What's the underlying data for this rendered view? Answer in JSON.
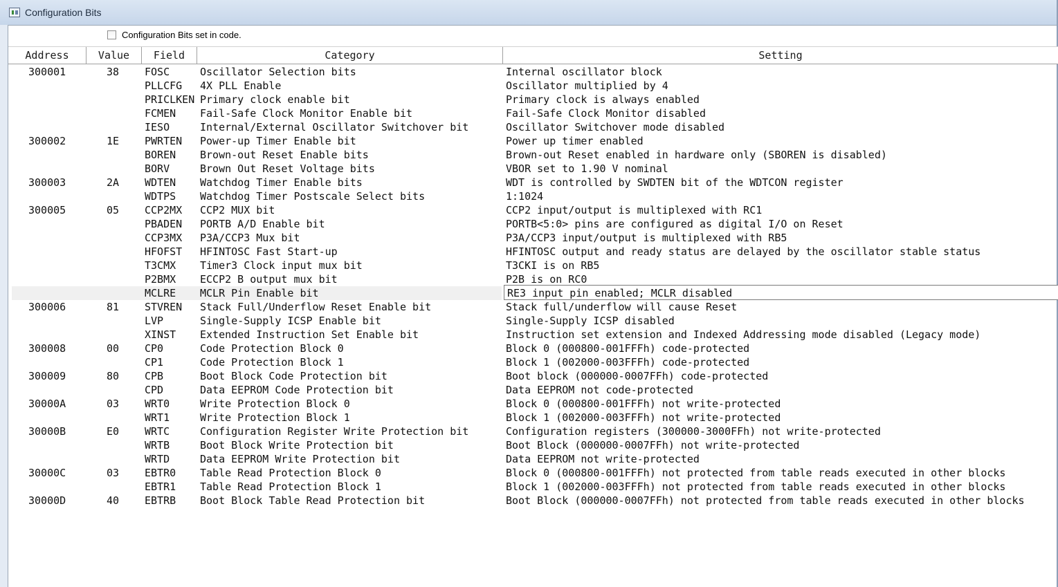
{
  "window": {
    "title": "Configuration Bits"
  },
  "options": {
    "set_in_code_label": "Configuration Bits set in code.",
    "set_in_code_checked": false
  },
  "table": {
    "columns": [
      "Address",
      "Value",
      "Field",
      "Category",
      "Setting"
    ],
    "selected_row": 16,
    "rows": [
      {
        "address": "300001",
        "value": "38",
        "field": "FOSC",
        "category": "Oscillator Selection bits",
        "setting": "Internal oscillator block"
      },
      {
        "address": "",
        "value": "",
        "field": "PLLCFG",
        "category": "4X PLL Enable",
        "setting": "Oscillator multiplied by 4"
      },
      {
        "address": "",
        "value": "",
        "field": "PRICLKEN",
        "category": "Primary clock enable bit",
        "setting": "Primary clock is always enabled"
      },
      {
        "address": "",
        "value": "",
        "field": "FCMEN",
        "category": "Fail-Safe Clock Monitor Enable bit",
        "setting": "Fail-Safe Clock Monitor disabled"
      },
      {
        "address": "",
        "value": "",
        "field": "IESO",
        "category": "Internal/External Oscillator Switchover bit",
        "setting": "Oscillator Switchover mode disabled"
      },
      {
        "address": "300002",
        "value": "1E",
        "field": "PWRTEN",
        "category": "Power-up Timer Enable bit",
        "setting": "Power up timer enabled"
      },
      {
        "address": "",
        "value": "",
        "field": "BOREN",
        "category": "Brown-out Reset Enable bits",
        "setting": "Brown-out Reset enabled in hardware only (SBOREN is disabled)"
      },
      {
        "address": "",
        "value": "",
        "field": "BORV",
        "category": "Brown Out Reset Voltage bits",
        "setting": "VBOR set to 1.90 V nominal"
      },
      {
        "address": "300003",
        "value": "2A",
        "field": "WDTEN",
        "category": "Watchdog Timer Enable bits",
        "setting": "WDT is controlled by SWDTEN bit of the WDTCON register"
      },
      {
        "address": "",
        "value": "",
        "field": "WDTPS",
        "category": "Watchdog Timer Postscale Select bits",
        "setting": "1:1024"
      },
      {
        "address": "300005",
        "value": "05",
        "field": "CCP2MX",
        "category": "CCP2 MUX bit",
        "setting": "CCP2 input/output is multiplexed with RC1"
      },
      {
        "address": "",
        "value": "",
        "field": "PBADEN",
        "category": "PORTB A/D Enable bit",
        "setting": "PORTB<5:0> pins are configured as digital I/O on Reset"
      },
      {
        "address": "",
        "value": "",
        "field": "CCP3MX",
        "category": "P3A/CCP3 Mux bit",
        "setting": "P3A/CCP3 input/output is multiplexed with RB5"
      },
      {
        "address": "",
        "value": "",
        "field": "HFOFST",
        "category": "HFINTOSC Fast Start-up",
        "setting": "HFINTOSC output and ready status are delayed by the oscillator stable status"
      },
      {
        "address": "",
        "value": "",
        "field": "T3CMX",
        "category": "Timer3 Clock input mux bit",
        "setting": "T3CKI is on RB5"
      },
      {
        "address": "",
        "value": "",
        "field": "P2BMX",
        "category": "ECCP2 B output mux bit",
        "setting": "P2B is on RC0"
      },
      {
        "address": "",
        "value": "",
        "field": "MCLRE",
        "category": "MCLR Pin Enable bit",
        "setting": "RE3 input pin enabled; MCLR disabled"
      },
      {
        "address": "300006",
        "value": "81",
        "field": "STVREN",
        "category": "Stack Full/Underflow Reset Enable bit",
        "setting": "Stack full/underflow will cause Reset"
      },
      {
        "address": "",
        "value": "",
        "field": "LVP",
        "category": "Single-Supply ICSP Enable bit",
        "setting": "Single-Supply ICSP disabled"
      },
      {
        "address": "",
        "value": "",
        "field": "XINST",
        "category": "Extended Instruction Set Enable bit",
        "setting": "Instruction set extension and Indexed Addressing mode disabled (Legacy mode)"
      },
      {
        "address": "300008",
        "value": "00",
        "field": "CP0",
        "category": "Code Protection Block 0",
        "setting": "Block 0 (000800-001FFFh) code-protected"
      },
      {
        "address": "",
        "value": "",
        "field": "CP1",
        "category": "Code Protection Block 1",
        "setting": "Block 1 (002000-003FFFh) code-protected"
      },
      {
        "address": "300009",
        "value": "80",
        "field": "CPB",
        "category": "Boot Block Code Protection bit",
        "setting": "Boot block (000000-0007FFh) code-protected"
      },
      {
        "address": "",
        "value": "",
        "field": "CPD",
        "category": "Data EEPROM Code Protection bit",
        "setting": "Data EEPROM not code-protected"
      },
      {
        "address": "30000A",
        "value": "03",
        "field": "WRT0",
        "category": "Write Protection Block 0",
        "setting": "Block 0 (000800-001FFFh) not write-protected"
      },
      {
        "address": "",
        "value": "",
        "field": "WRT1",
        "category": "Write Protection Block 1",
        "setting": "Block 1 (002000-003FFFh) not write-protected"
      },
      {
        "address": "30000B",
        "value": "E0",
        "field": "WRTC",
        "category": "Configuration Register Write Protection bit",
        "setting": "Configuration registers (300000-3000FFh) not write-protected"
      },
      {
        "address": "",
        "value": "",
        "field": "WRTB",
        "category": "Boot Block Write Protection bit",
        "setting": "Boot Block (000000-0007FFh) not write-protected"
      },
      {
        "address": "",
        "value": "",
        "field": "WRTD",
        "category": "Data EEPROM Write Protection bit",
        "setting": "Data EEPROM not write-protected"
      },
      {
        "address": "30000C",
        "value": "03",
        "field": "EBTR0",
        "category": "Table Read Protection Block 0",
        "setting": "Block 0 (000800-001FFFh) not protected from table reads executed in other blocks"
      },
      {
        "address": "",
        "value": "",
        "field": "EBTR1",
        "category": "Table Read Protection Block 1",
        "setting": "Block 1 (002000-003FFFh) not protected from table reads executed in other blocks"
      },
      {
        "address": "30000D",
        "value": "40",
        "field": "EBTRB",
        "category": "Boot Block Table Read Protection bit",
        "setting": "Boot Block (000000-0007FFh) not protected from table reads executed in other blocks"
      }
    ]
  }
}
